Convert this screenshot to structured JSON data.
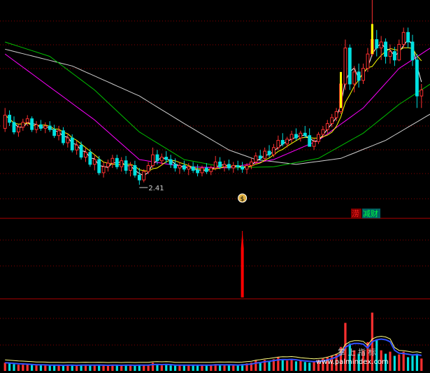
{
  "chart_data": {
    "type": "candlestick",
    "panels": [
      "price",
      "signal",
      "volume"
    ],
    "price": {
      "ylim": [
        2.2,
        3.95
      ],
      "low_marker": {
        "value": 2.41,
        "label": "2.41"
      },
      "candles": [
        [
          2.88,
          3.05,
          2.85,
          2.99
        ],
        [
          2.99,
          3.03,
          2.9,
          2.93
        ],
        [
          2.93,
          2.98,
          2.83,
          2.85
        ],
        [
          2.85,
          2.92,
          2.81,
          2.89
        ],
        [
          2.89,
          2.96,
          2.86,
          2.93
        ],
        [
          2.93,
          2.99,
          2.9,
          2.96
        ],
        [
          2.96,
          2.98,
          2.85,
          2.87
        ],
        [
          2.87,
          2.94,
          2.84,
          2.91
        ],
        [
          2.91,
          2.95,
          2.86,
          2.88
        ],
        [
          2.88,
          2.93,
          2.84,
          2.9
        ],
        [
          2.9,
          2.94,
          2.85,
          2.87
        ],
        [
          2.87,
          2.91,
          2.8,
          2.82
        ],
        [
          2.82,
          2.9,
          2.78,
          2.86
        ],
        [
          2.86,
          2.89,
          2.74,
          2.76
        ],
        [
          2.76,
          2.84,
          2.72,
          2.8
        ],
        [
          2.8,
          2.83,
          2.68,
          2.7
        ],
        [
          2.7,
          2.78,
          2.66,
          2.74
        ],
        [
          2.74,
          2.77,
          2.62,
          2.64
        ],
        [
          2.64,
          2.72,
          2.6,
          2.68
        ],
        [
          2.68,
          2.71,
          2.56,
          2.58
        ],
        [
          2.58,
          2.66,
          2.53,
          2.62
        ],
        [
          2.62,
          2.65,
          2.49,
          2.51
        ],
        [
          2.51,
          2.6,
          2.47,
          2.56
        ],
        [
          2.56,
          2.62,
          2.52,
          2.59
        ],
        [
          2.59,
          2.66,
          2.55,
          2.63
        ],
        [
          2.63,
          2.66,
          2.54,
          2.56
        ],
        [
          2.56,
          2.64,
          2.52,
          2.61
        ],
        [
          2.61,
          2.65,
          2.5,
          2.53
        ],
        [
          2.53,
          2.6,
          2.48,
          2.57
        ],
        [
          2.57,
          2.61,
          2.47,
          2.49
        ],
        [
          2.49,
          2.55,
          2.41,
          2.45
        ],
        [
          2.45,
          2.54,
          2.43,
          2.52
        ],
        [
          2.52,
          2.6,
          2.5,
          2.57
        ],
        [
          2.57,
          2.72,
          2.55,
          2.66
        ],
        [
          2.66,
          2.7,
          2.58,
          2.61
        ],
        [
          2.61,
          2.67,
          2.57,
          2.64
        ],
        [
          2.64,
          2.69,
          2.59,
          2.62
        ],
        [
          2.62,
          2.66,
          2.55,
          2.58
        ],
        [
          2.58,
          2.63,
          2.52,
          2.55
        ],
        [
          2.55,
          2.6,
          2.5,
          2.57
        ],
        [
          2.57,
          2.61,
          2.52,
          2.54
        ],
        [
          2.54,
          2.59,
          2.49,
          2.56
        ],
        [
          2.56,
          2.6,
          2.51,
          2.53
        ],
        [
          2.53,
          2.58,
          2.48,
          2.51
        ],
        [
          2.51,
          2.57,
          2.48,
          2.55
        ],
        [
          2.55,
          2.59,
          2.5,
          2.52
        ],
        [
          2.52,
          2.57,
          2.49,
          2.55
        ],
        [
          2.55,
          2.65,
          2.53,
          2.6
        ],
        [
          2.6,
          2.64,
          2.54,
          2.56
        ],
        [
          2.56,
          2.61,
          2.52,
          2.58
        ],
        [
          2.58,
          2.62,
          2.53,
          2.55
        ],
        [
          2.55,
          2.6,
          2.51,
          2.57
        ],
        [
          2.57,
          2.61,
          2.53,
          2.56
        ],
        [
          2.56,
          2.6,
          2.51,
          2.54
        ],
        [
          2.54,
          2.59,
          2.5,
          2.57
        ],
        [
          2.57,
          2.63,
          2.54,
          2.6
        ],
        [
          2.6,
          2.68,
          2.58,
          2.65
        ],
        [
          2.65,
          2.7,
          2.61,
          2.63
        ],
        [
          2.63,
          2.72,
          2.61,
          2.69
        ],
        [
          2.69,
          2.74,
          2.64,
          2.66
        ],
        [
          2.66,
          2.75,
          2.64,
          2.72
        ],
        [
          2.72,
          2.82,
          2.7,
          2.78
        ],
        [
          2.78,
          2.84,
          2.73,
          2.75
        ],
        [
          2.75,
          2.81,
          2.72,
          2.79
        ],
        [
          2.79,
          2.86,
          2.76,
          2.83
        ],
        [
          2.83,
          2.88,
          2.78,
          2.8
        ],
        [
          2.8,
          2.86,
          2.77,
          2.84
        ],
        [
          2.84,
          2.9,
          2.8,
          2.82
        ],
        [
          2.82,
          2.88,
          2.78,
          2.73
        ],
        [
          2.73,
          2.8,
          2.7,
          2.77
        ],
        [
          2.77,
          2.85,
          2.75,
          2.83
        ],
        [
          2.83,
          2.9,
          2.8,
          2.87
        ],
        [
          2.87,
          2.95,
          2.84,
          2.92
        ],
        [
          2.92,
          3.0,
          2.89,
          2.97
        ],
        [
          2.97,
          3.05,
          2.94,
          3.02
        ],
        [
          3.02,
          3.3,
          3.0,
          3.25
        ],
        [
          3.25,
          3.62,
          3.2,
          3.55
        ],
        [
          3.55,
          3.58,
          3.2,
          3.25
        ],
        [
          3.25,
          3.4,
          3.18,
          3.35
        ],
        [
          3.35,
          3.42,
          3.22,
          3.28
        ],
        [
          3.28,
          3.42,
          3.25,
          3.38
        ],
        [
          3.38,
          3.55,
          3.35,
          3.5
        ],
        [
          3.5,
          3.95,
          3.48,
          3.62
        ],
        [
          3.62,
          3.7,
          3.48,
          3.55
        ],
        [
          3.55,
          3.65,
          3.45,
          3.6
        ],
        [
          3.6,
          3.63,
          3.42,
          3.48
        ],
        [
          3.48,
          3.58,
          3.42,
          3.52
        ],
        [
          3.52,
          3.56,
          3.4,
          3.45
        ],
        [
          3.45,
          3.62,
          3.44,
          3.58
        ],
        [
          3.58,
          3.72,
          3.55,
          3.68
        ],
        [
          3.68,
          3.72,
          3.55,
          3.6
        ],
        [
          3.6,
          3.66,
          3.4,
          3.45
        ],
        [
          3.45,
          3.5,
          3.05,
          3.15
        ],
        [
          3.15,
          3.25,
          3.05,
          3.2
        ]
      ],
      "yellow_spikes": [
        [
          75,
          3.05,
          3.35
        ],
        [
          82,
          3.5,
          3.75
        ]
      ],
      "ma_short_color": "#ffffff",
      "ma_mid_color": "#ffff00",
      "ma_20_color": "#ff00ff",
      "ma_60_color": "#00c000",
      "ma_120_color": "#d0d0d0",
      "ma_20_points": [
        [
          0,
          3.5
        ],
        [
          20,
          2.95
        ],
        [
          30,
          2.62
        ],
        [
          40,
          2.56
        ],
        [
          50,
          2.55
        ],
        [
          60,
          2.62
        ],
        [
          70,
          2.78
        ],
        [
          80,
          3.05
        ],
        [
          88,
          3.38
        ],
        [
          95,
          3.55
        ]
      ],
      "ma_60_points": [
        [
          0,
          3.6
        ],
        [
          10,
          3.48
        ],
        [
          20,
          3.2
        ],
        [
          30,
          2.85
        ],
        [
          40,
          2.62
        ],
        [
          50,
          2.55
        ],
        [
          60,
          2.56
        ],
        [
          70,
          2.63
        ],
        [
          80,
          2.84
        ],
        [
          88,
          3.08
        ],
        [
          95,
          3.25
        ]
      ],
      "ma_120_points": [
        [
          0,
          3.54
        ],
        [
          15,
          3.4
        ],
        [
          30,
          3.15
        ],
        [
          40,
          2.92
        ],
        [
          50,
          2.7
        ],
        [
          56,
          2.62
        ],
        [
          65,
          2.58
        ],
        [
          75,
          2.63
        ],
        [
          85,
          2.78
        ],
        [
          95,
          3.0
        ]
      ],
      "buy_icon_index": 53,
      "buy_icon": "money-bag-icon",
      "badges": [
        {
          "label": "涝",
          "color": "#ff2020",
          "bg": "#800000"
        },
        {
          "label": "减财",
          "color": "#00ff40",
          "bg": "#006060"
        }
      ]
    },
    "signal": {
      "spike_index": 53,
      "value": 1,
      "color": "#ff0000"
    },
    "volume": {
      "values": [
        1.2,
        1.1,
        1.0,
        0.9,
        0.9,
        1.0,
        0.9,
        0.8,
        0.9,
        0.8,
        0.8,
        0.9,
        0.8,
        0.8,
        0.9,
        0.8,
        0.8,
        0.9,
        0.9,
        0.8,
        0.8,
        0.9,
        0.8,
        0.8,
        0.9,
        0.8,
        0.8,
        0.9,
        0.8,
        0.8,
        0.9,
        0.8,
        0.9,
        1.2,
        0.9,
        0.8,
        0.9,
        0.8,
        0.8,
        0.9,
        0.8,
        0.9,
        0.8,
        0.8,
        0.9,
        0.8,
        0.9,
        1.0,
        0.9,
        0.8,
        0.9,
        0.8,
        0.9,
        1.0,
        1.1,
        1.2,
        1.5,
        1.3,
        1.6,
        1.4,
        1.7,
        2.0,
        1.6,
        1.5,
        1.6,
        1.4,
        1.5,
        1.3,
        1.2,
        1.4,
        1.6,
        1.8,
        2.0,
        2.2,
        2.5,
        3.5,
        7.0,
        4.0,
        3.0,
        2.5,
        3.0,
        4.2,
        8.5,
        4.5,
        3.0,
        2.5,
        2.8,
        2.2,
        2.4,
        2.8,
        2.0,
        2.2,
        2.5,
        1.8
      ],
      "ylim": [
        0,
        10
      ],
      "avg_color": "#3050ff",
      "watermark": "掌 上 指 标",
      "watermark_url": "www.palmindex.com"
    },
    "grid": true
  }
}
